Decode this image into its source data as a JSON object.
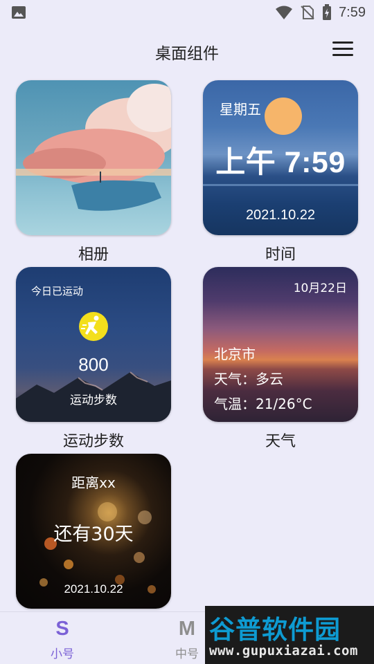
{
  "status_bar": {
    "left_icon": "image-notification-icon",
    "right_icons": [
      "wifi-icon",
      "no-sim-icon",
      "battery-charging-icon"
    ],
    "time": "7:59"
  },
  "header": {
    "title": "桌面组件",
    "menu_icon": "hamburger-menu-icon"
  },
  "widgets": [
    {
      "id": "album",
      "label": "相册"
    },
    {
      "id": "time",
      "label": "时间",
      "weekday": "星期五",
      "time": "上午 7:59",
      "date": "2021.10.22"
    },
    {
      "id": "steps",
      "label": "运动步数",
      "caption": "今日已运动",
      "count": "800",
      "unit": "运动步数"
    },
    {
      "id": "weather",
      "label": "天气",
      "date": "10月22日",
      "city": "北京市",
      "condition": "天气：多云",
      "temperature": "气温：21/26°C"
    },
    {
      "id": "countdown",
      "title": "距离xx",
      "main": "还有30天",
      "date": "2021.10.22"
    }
  ],
  "bottom_nav": {
    "active_color": "#7b61d6",
    "inactive_color": "#8e8e8e",
    "items": [
      {
        "icon": "S",
        "label": "小号",
        "active": true
      },
      {
        "icon": "M",
        "label": "中号",
        "active": false
      }
    ]
  },
  "watermark": {
    "title": "谷普软件园",
    "url": "www.gupuxiazai.com"
  }
}
